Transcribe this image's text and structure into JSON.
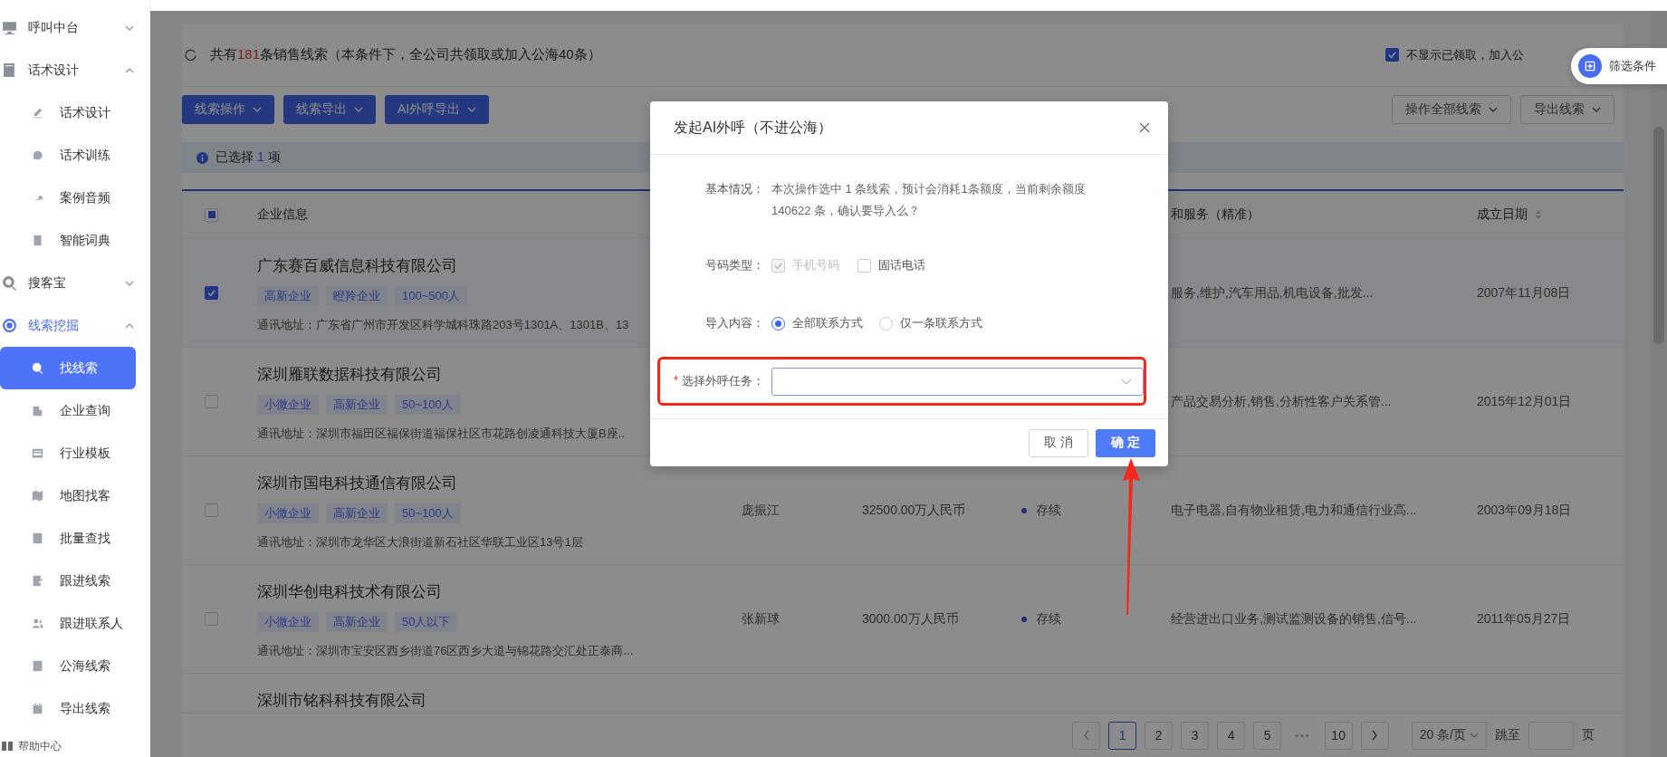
{
  "sidebar": {
    "items": [
      {
        "label": "呼叫中台",
        "expanded": false,
        "selected": false
      },
      {
        "label": "话术设计",
        "expanded": true,
        "selected": false,
        "children": [
          {
            "label": "话术设计",
            "selected": false
          },
          {
            "label": "话术训练",
            "selected": false
          },
          {
            "label": "案例音频",
            "selected": false
          },
          {
            "label": "智能词典",
            "selected": false
          }
        ]
      },
      {
        "label": "搜客宝",
        "expanded": false,
        "selected": false
      },
      {
        "label": "线索挖掘",
        "expanded": true,
        "selected": true,
        "children": [
          {
            "label": "找线索",
            "selected": true
          },
          {
            "label": "企业查询",
            "selected": false
          },
          {
            "label": "行业模板",
            "selected": false
          },
          {
            "label": "地图找客",
            "selected": false
          },
          {
            "label": "批量查找",
            "selected": false
          },
          {
            "label": "跟进线索",
            "selected": false
          },
          {
            "label": "跟进联系人",
            "selected": false
          },
          {
            "label": "公海线索",
            "selected": false
          },
          {
            "label": "导出线索",
            "selected": false
          }
        ]
      }
    ],
    "help": "帮助中心"
  },
  "summary": {
    "prefix": "共有",
    "count": "181",
    "suffix": "条销售线索（本条件下，全公司共领取或加入公海40条）"
  },
  "hide_claimed": {
    "label": "不显示已领取，加入公",
    "checked": true
  },
  "filter_button": "筛选条件",
  "toolbar": {
    "left": [
      "线索操作",
      "线索导出",
      "AI外呼导出"
    ],
    "right": [
      "操作全部线索",
      "导出线索"
    ]
  },
  "selection": {
    "prefix": "已选择",
    "count": "1",
    "suffix": "项"
  },
  "table": {
    "header_checked": false,
    "header_indeterminate": true,
    "columns": {
      "company": "企业信息",
      "scope": "和服务（精准）",
      "date": "成立日期"
    },
    "rows": [
      {
        "checked": true,
        "name": "广东赛百威信息科技有限公司",
        "tags": [
          "高新企业",
          "瞪羚企业",
          "100~500人"
        ],
        "address": "通讯地址：广东省广州市开发区科学城科珠路203号1301A、1301B、13",
        "scope": "服务,维护,汽车用品,机电设备,批发...",
        "date": "2007年11月08日"
      },
      {
        "checked": false,
        "name": "深圳雁联数据科技有限公司",
        "tags": [
          "小微企业",
          "高新企业",
          "50~100人"
        ],
        "address": "通讯地址：深圳市福田区福保街道福保社区市花路创凌通科技大厦B座..",
        "scope": "产品交易分析,销售,分析性客户关系管...",
        "date": "2015年12月01日"
      },
      {
        "checked": false,
        "name": "深圳市国电科技通信有限公司",
        "tags": [
          "小微企业",
          "高新企业",
          "50~100人"
        ],
        "address": "通讯地址：深圳市龙华区大浪街道新石社区华联工业区13号1层",
        "legal_person": "庞振江",
        "capital": "32500.00万人民币",
        "status": "存续",
        "scope": "电子电器,自有物业租赁,电力和通信行业高...",
        "date": "2003年09月18日"
      },
      {
        "checked": false,
        "name": "深圳华创电科技术有限公司",
        "tags": [
          "小微企业",
          "高新企业",
          "50人以下"
        ],
        "address": "通讯地址：深圳市宝安区西乡街道76区西乡大道与锦花路交汇处正泰商...",
        "legal_person": "张新球",
        "capital": "3000.00万人民币",
        "status": "存续",
        "scope": "经营进出口业务,测试监测设备的销售,信号...",
        "date": "2011年05月27日"
      },
      {
        "name": "深圳市铭科科技有限公司"
      }
    ]
  },
  "pagination": {
    "items": [
      {
        "kind": "page",
        "label": "1",
        "selected": true
      },
      {
        "kind": "page",
        "label": "2",
        "selected": false
      },
      {
        "kind": "page",
        "label": "3",
        "selected": false
      },
      {
        "kind": "page",
        "label": "4",
        "selected": false
      },
      {
        "kind": "page",
        "label": "5",
        "selected": false
      },
      {
        "kind": "ellipsis",
        "label": "•••"
      },
      {
        "kind": "page",
        "label": "10",
        "selected": false
      }
    ],
    "page_size": "20 条/页",
    "jump_label": "跳至",
    "page_suffix": "页"
  },
  "dialog": {
    "title": "发起AI外呼（不进公海）",
    "info_label": "基本情况：",
    "info_text": "本次操作选中 1 条线索，预计会消耗1条额度，当前剩余额度 140622 条，确认要导入么？",
    "number_type": {
      "label": "号码类型：",
      "options": [
        {
          "label": "手机号码",
          "checked": true,
          "disabled": true
        },
        {
          "label": "固话电话",
          "checked": false,
          "disabled": false
        }
      ]
    },
    "import_content": {
      "label": "导入内容：",
      "options": [
        {
          "label": "全部联系方式",
          "selected": true
        },
        {
          "label": "仅一条联系方式",
          "selected": false
        }
      ]
    },
    "task": {
      "required_mark": "*",
      "label": "选择外呼任务："
    },
    "buttons": [
      {
        "label": "取 消",
        "kind": "secondary"
      },
      {
        "label": "确 定",
        "kind": "primary"
      }
    ]
  },
  "annotations": {
    "highlight_task_field": true,
    "arrow_to_confirm": true
  }
}
